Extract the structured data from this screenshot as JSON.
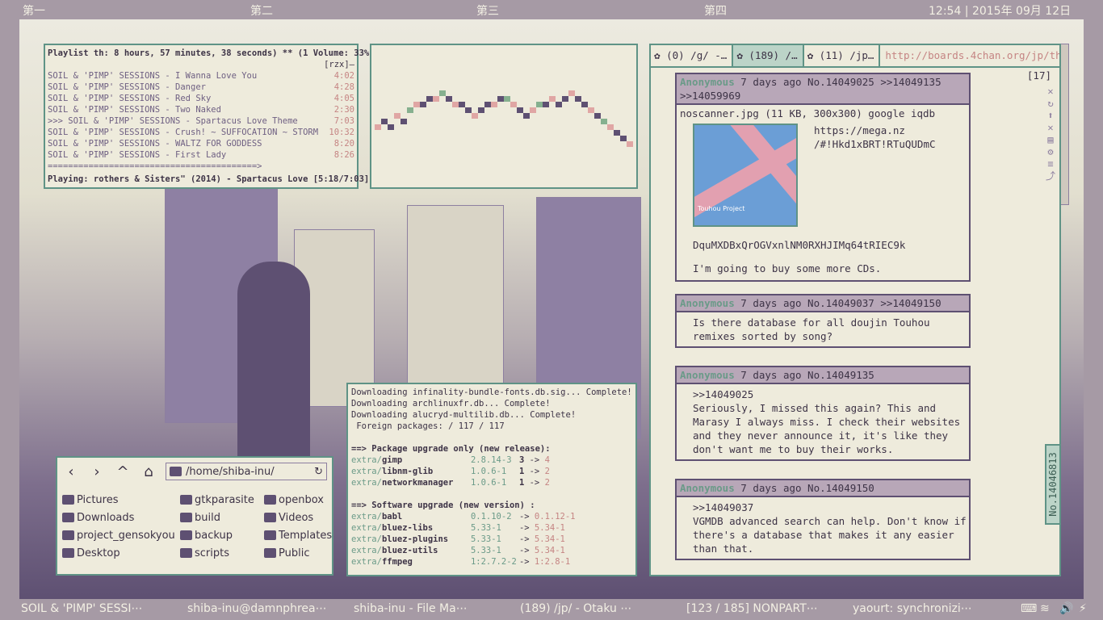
{
  "topbar": {
    "ws1": "第一",
    "ws2": "第二",
    "ws3": "第三",
    "ws4": "第四",
    "clock": "12:54 | 2015年 09月 12日"
  },
  "player": {
    "header": "Playlist th: 8 hours, 57 minutes, 38 seconds) ** (1 Volume: 33%",
    "tag": "[rzx]–",
    "tracks": [
      {
        "title": "SOIL & 'PIMP' SESSIONS - I Wanna Love You",
        "dur": "4:02"
      },
      {
        "title": "SOIL & 'PIMP' SESSIONS - Danger",
        "dur": "4:28"
      },
      {
        "title": "SOIL & 'PIMP' SESSIONS - Red Sky",
        "dur": "4:05"
      },
      {
        "title": "SOIL & 'PIMP' SESSIONS - Two Naked",
        "dur": "2:30"
      },
      {
        "title": ">>> SOIL & 'PIMP' SESSIONS - Spartacus Love Theme",
        "dur": "7:03"
      },
      {
        "title": "SOIL & 'PIMP' SESSIONS - Crush! ~ SUFFOCATION ~ STORM",
        "dur": "10:32"
      },
      {
        "title": "SOIL & 'PIMP' SESSIONS - WALTZ FOR GODDESS",
        "dur": "8:20"
      },
      {
        "title": "SOIL & 'PIMP' SESSIONS - First Lady",
        "dur": "8:26"
      }
    ],
    "progress": "=========================================>",
    "playing": "Playing: rothers & Sisters\" (2014) - Spartacus Love [5:18/7:03]"
  },
  "terminal": {
    "lines": [
      "Downloading infinality-bundle-fonts.db.sig... Complete!",
      "Downloading archlinuxfr.db... Complete!",
      "Downloading alucryd-multilib.db... Complete!",
      " Foreign packages: / 117 / 117"
    ],
    "h1": "==> Package upgrade only (new release):",
    "h2": "==> Software upgrade (new version) :",
    "pkg1": [
      {
        "repo": "extra/",
        "name": "gimp",
        "old": "2.8.14-3",
        "a": "3",
        "arr": "->",
        "n": "4"
      },
      {
        "repo": "extra/",
        "name": "libnm-glib",
        "old": "1.0.6-1",
        "a": "1",
        "arr": "->",
        "n": "2"
      },
      {
        "repo": "extra/",
        "name": "networkmanager",
        "old": "1.0.6-1",
        "a": "1",
        "arr": "->",
        "n": "2"
      }
    ],
    "pkg2": [
      {
        "repo": "extra/",
        "name": "babl",
        "old": "0.1.10-2",
        "arr": "->",
        "n": "0.1.12-1"
      },
      {
        "repo": "extra/",
        "name": "bluez-libs",
        "old": "5.33-1",
        "arr": "->",
        "n": "5.34-1"
      },
      {
        "repo": "extra/",
        "name": "bluez-plugins",
        "old": "5.33-1",
        "arr": "->",
        "n": "5.34-1"
      },
      {
        "repo": "extra/",
        "name": "bluez-utils",
        "old": "5.33-1",
        "arr": "->",
        "n": "5.34-1"
      },
      {
        "repo": "extra/",
        "name": "ffmpeg",
        "old": "1:2.7.2-2",
        "arr": "->",
        "n": "1:2.8-1"
      }
    ]
  },
  "filemanager": {
    "path": "/home/shiba-inu/",
    "items": [
      "Pictures",
      "Downloads",
      "project_gensokyou",
      "Desktop",
      "gtkparasite",
      "build",
      "backup",
      "scripts",
      "openbox",
      "Videos",
      "Templates",
      "Public"
    ]
  },
  "browser": {
    "tabs": [
      "(0) /g/ -…",
      "(189) /…",
      "(11) /jp…"
    ],
    "url": "http://boards.4chan.org/jp/th",
    "count": "[17]",
    "side_tab": "No.14046813",
    "posts": [
      {
        "name": "Anonymous",
        "meta": "7 days ago No.14049025 >>14049135",
        "meta2": ">>14059969",
        "file": "noscanner.jpg (11 KB, 300x300) google iqdb",
        "link": "https://mega.nz\n/#!Hkd1xBRT!RTuQUDmC",
        "key": "DquMXDBxQrOGVxnlNM0RXHJIMq64tRIEC9k",
        "body": "I'm going to buy some more CDs.",
        "thumb": "Touhou Project"
      },
      {
        "name": "Anonymous",
        "meta": "7 days ago No.14049037 >>14049150",
        "body": "Is there database for all doujin Touhou\nremixes sorted by song?"
      },
      {
        "name": "Anonymous",
        "meta": "7 days ago No.14049135",
        "body": ">>14049025\nSeriously, I missed this again? This and\nMarasy I always miss. I check their websites\nand they never announce it, it's like they\ndon't want me to buy their works."
      },
      {
        "name": "Anonymous",
        "meta": "7 days ago No.14049150",
        "body": ">>14049037\nVGMDB advanced search can help. Don't know if\nthere's a database that makes it any easier\nthan that."
      }
    ]
  },
  "taskbar": [
    "SOIL & 'PIMP' SESSI⋯",
    "shiba-inu@damnphrea⋯",
    "shiba-inu - File Ma⋯",
    "(189) /jp/ - Otaku ⋯",
    "[123 / 185] NONPART⋯",
    "yaourt: synchronizi⋯"
  ],
  "tray": [
    "⌨",
    "≋",
    "🔊",
    "⚡"
  ]
}
